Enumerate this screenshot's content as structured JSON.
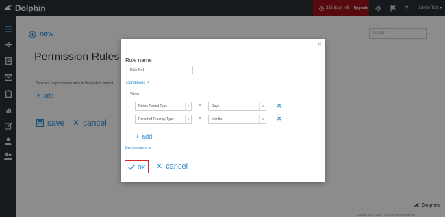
{
  "app": {
    "name": "Dolphin",
    "suffix": "365"
  },
  "topbar": {
    "trial_text": "225 days left -",
    "upgrade_label": "Upgrade",
    "user_name": "Admin Test ▾",
    "accent_color": "#a0141a"
  },
  "sidebar": {
    "items": [
      {
        "icon": "menu-icon"
      },
      {
        "icon": "plane-icon"
      },
      {
        "icon": "document-icon"
      },
      {
        "icon": "mail-icon"
      },
      {
        "icon": "clipboard-icon"
      },
      {
        "icon": "bar-chart-icon"
      },
      {
        "icon": "edit-icon"
      },
      {
        "icon": "user-icon"
      },
      {
        "icon": "users-icon"
      }
    ]
  },
  "main": {
    "new_label": "new",
    "search_placeholder": "Search",
    "title": "Permission Rules",
    "empty_message": "There are no permission rules in the system current",
    "add_label": "add",
    "save_label": "save",
    "cancel_label": "cancel",
    "footer_brand": "Dolphin",
    "footer_text": "Dolphin 365 © 2016 - 2018 All Rights Reserved"
  },
  "modal": {
    "rule_name_label": "Rule name",
    "rule_name_value": "Rule No1",
    "conditions_label": "Conditions ˅",
    "when_label": "When",
    "conditions": [
      {
        "field": "Notice Period Type",
        "operator": "=",
        "value": "Days"
      },
      {
        "field": "Period of Tenancy Type",
        "operator": "=",
        "value": "Months"
      }
    ],
    "add_label": "add",
    "permissions_label": "Permissions »",
    "ok_label": "ok",
    "cancel_label": "cancel"
  }
}
